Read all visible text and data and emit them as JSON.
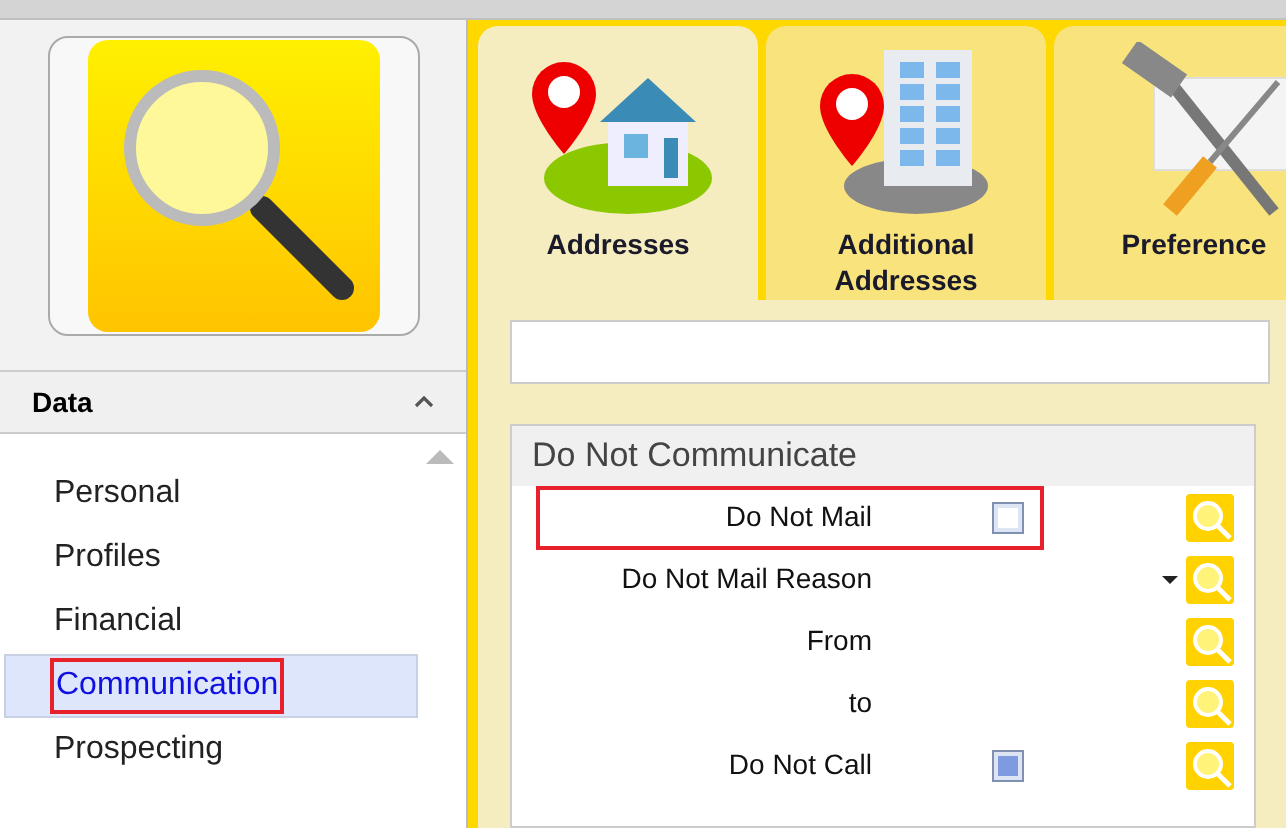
{
  "sidebar": {
    "section": {
      "title": "Data",
      "expanded": true
    },
    "items": [
      {
        "label": "Personal",
        "selected": false,
        "highlighted": false
      },
      {
        "label": "Profiles",
        "selected": false,
        "highlighted": false
      },
      {
        "label": "Financial",
        "selected": false,
        "highlighted": false
      },
      {
        "label": "Communication",
        "selected": true,
        "highlighted": true
      },
      {
        "label": "Prospecting",
        "selected": false,
        "highlighted": false
      }
    ]
  },
  "tabs": [
    {
      "label": "Addresses",
      "kind": "house",
      "selected": true
    },
    {
      "label": "Additional Addresses",
      "kind": "building",
      "selected": false
    },
    {
      "label": "Preference",
      "kind": "tools",
      "selected": false
    }
  ],
  "group": {
    "title": "Do Not Communicate",
    "rows": [
      {
        "label": "Do Not Mail",
        "kind": "checkbox",
        "checked": false,
        "highlighted": true
      },
      {
        "label": "Do Not Mail Reason",
        "kind": "dropdown",
        "highlighted": false
      },
      {
        "label": "From",
        "kind": "text",
        "highlighted": false
      },
      {
        "label": "to",
        "kind": "text",
        "highlighted": false
      },
      {
        "label": "Do Not Call",
        "kind": "checkbox",
        "checked": true,
        "highlighted": false
      }
    ]
  }
}
